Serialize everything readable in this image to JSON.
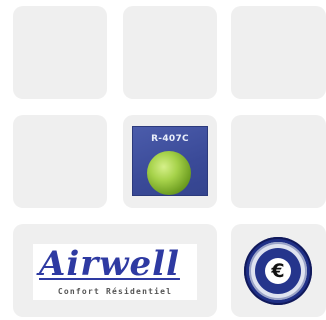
{
  "grid": {
    "tiles": [
      {
        "name": "empty"
      },
      {
        "name": "empty"
      },
      {
        "name": "empty"
      },
      {
        "name": "empty"
      },
      {
        "name": "r407c-badge"
      },
      {
        "name": "empty"
      },
      {
        "name": "airwell-logo"
      },
      {
        "name": "euro-seal"
      }
    ]
  },
  "badge": {
    "label": "R-407C"
  },
  "airwell": {
    "word": "Airwell",
    "tagline": "Confort Résidentiel",
    "color": "#2e3aa2"
  },
  "seal": {
    "symbol": "€",
    "icon": "euro-seal-icon"
  },
  "colors": {
    "tile_bg": "#efefef",
    "badge_blue": "#3a4a98",
    "ball_green": "#8fbf3a"
  }
}
